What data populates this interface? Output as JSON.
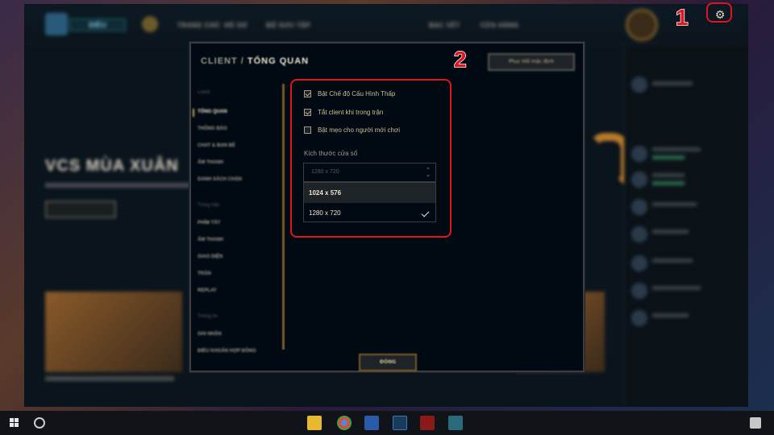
{
  "client": {
    "play_label": "ĐIỀU",
    "nav": [
      "TRANG CHỦ",
      "HỒ SƠ",
      "BỘ SƯU TẬP",
      "BẠC VẾT",
      "CỬA HÀNG"
    ],
    "hero_title": "VCS MÙA XUÂN",
    "gear_icon": "gear-icon"
  },
  "settings": {
    "title_prefix": "CLIENT /",
    "title_main": "TỔNG QUAN",
    "restore_label": "Phục Hồi mặc định",
    "nav_groups": [
      {
        "head": "Client",
        "links": [
          "TỔNG QUAN",
          "THÔNG BÁO",
          "CHAT & BẠN BÈ",
          "ÂM THANH",
          "DANH SÁCH CHẶN"
        ]
      },
      {
        "head": "Trong trận",
        "links": [
          "PHÍM TẮT",
          "ÂM THANH",
          "GIAO DIỆN",
          "TRẬN",
          "REPLAY"
        ]
      },
      {
        "head": "Thông tin",
        "links": [
          "GHI NHẬN",
          "ĐIỀU KHOẢN HỢP ĐỒNG"
        ]
      }
    ],
    "options": [
      {
        "label": "Bật Chế độ Cấu Hình Thấp",
        "checked": true
      },
      {
        "label": "Tắt client khi trong trận",
        "checked": true
      },
      {
        "label": "Bật mẹo cho người mới chơi",
        "checked": false
      }
    ],
    "window_size_label": "Kích thước cửa sổ",
    "dropdown_value": "1280 x 720",
    "dropdown_options": [
      "1024 x 576",
      "1280 x 720"
    ],
    "close_label": "ĐÓNG"
  },
  "annotations": {
    "step1": "1",
    "step2": "2",
    "highlight_color": "#e0141e"
  }
}
